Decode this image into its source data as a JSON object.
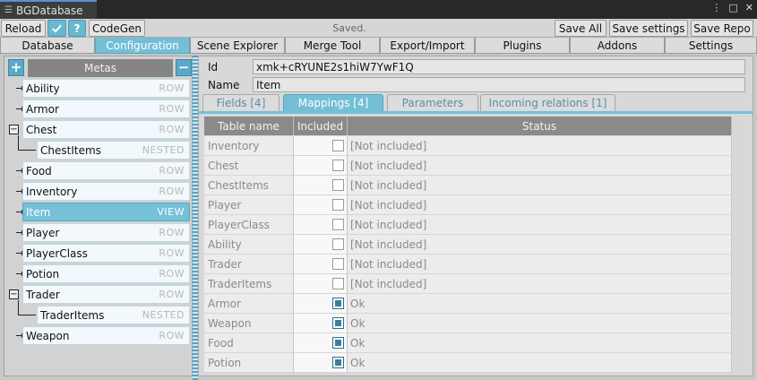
{
  "window": {
    "title": "BGDatabase",
    "controls": [
      "⋮",
      "□",
      "✕"
    ]
  },
  "toolbar": {
    "reload": "Reload",
    "codegen": "CodeGen",
    "status": "Saved.",
    "save_all": "Save All",
    "save_settings": "Save settings",
    "save_repo": "Save Repo"
  },
  "main_tabs": [
    "Database",
    "Configuration",
    "Scene Explorer",
    "Merge Tool",
    "Export/Import",
    "Plugins",
    "Addons",
    "Settings"
  ],
  "left": {
    "header": "Metas",
    "metas": [
      {
        "name": "Ability",
        "type": "ROW"
      },
      {
        "name": "Armor",
        "type": "ROW"
      },
      {
        "name": "Chest",
        "type": "ROW"
      },
      {
        "name": "ChestItems",
        "type": "NESTED"
      },
      {
        "name": "Food",
        "type": "ROW"
      },
      {
        "name": "Inventory",
        "type": "ROW"
      },
      {
        "name": "Item",
        "type": "VIEW"
      },
      {
        "name": "Player",
        "type": "ROW"
      },
      {
        "name": "PlayerClass",
        "type": "ROW"
      },
      {
        "name": "Potion",
        "type": "ROW"
      },
      {
        "name": "Trader",
        "type": "ROW"
      },
      {
        "name": "TraderItems",
        "type": "NESTED"
      },
      {
        "name": "Weapon",
        "type": "ROW"
      }
    ]
  },
  "right": {
    "id_label": "Id",
    "id_value": "xmk+cRYUNE2s1hiW7YwF1Q",
    "name_label": "Name",
    "name_value": "Item",
    "tabs": [
      "Fields [4]",
      "Mappings [4]",
      "Parameters",
      "Incoming relations [1]"
    ],
    "table": {
      "headers": [
        "Table name",
        "Included",
        "Status"
      ],
      "rows": [
        {
          "table": "Inventory",
          "included": false,
          "status": "[Not included]"
        },
        {
          "table": "Chest",
          "included": false,
          "status": "[Not included]"
        },
        {
          "table": "ChestItems",
          "included": false,
          "status": "[Not included]"
        },
        {
          "table": "Player",
          "included": false,
          "status": "[Not included]"
        },
        {
          "table": "PlayerClass",
          "included": false,
          "status": "[Not included]"
        },
        {
          "table": "Ability",
          "included": false,
          "status": "[Not included]"
        },
        {
          "table": "Trader",
          "included": false,
          "status": "[Not included]"
        },
        {
          "table": "TraderItems",
          "included": false,
          "status": "[Not included]"
        },
        {
          "table": "Armor",
          "included": true,
          "status": "Ok"
        },
        {
          "table": "Weapon",
          "included": true,
          "status": "Ok"
        },
        {
          "table": "Food",
          "included": true,
          "status": "Ok"
        },
        {
          "table": "Potion",
          "included": true,
          "status": "Ok"
        }
      ]
    }
  },
  "colors": {
    "accent": "#74bfd6",
    "header_gray": "#8a8a8a"
  }
}
